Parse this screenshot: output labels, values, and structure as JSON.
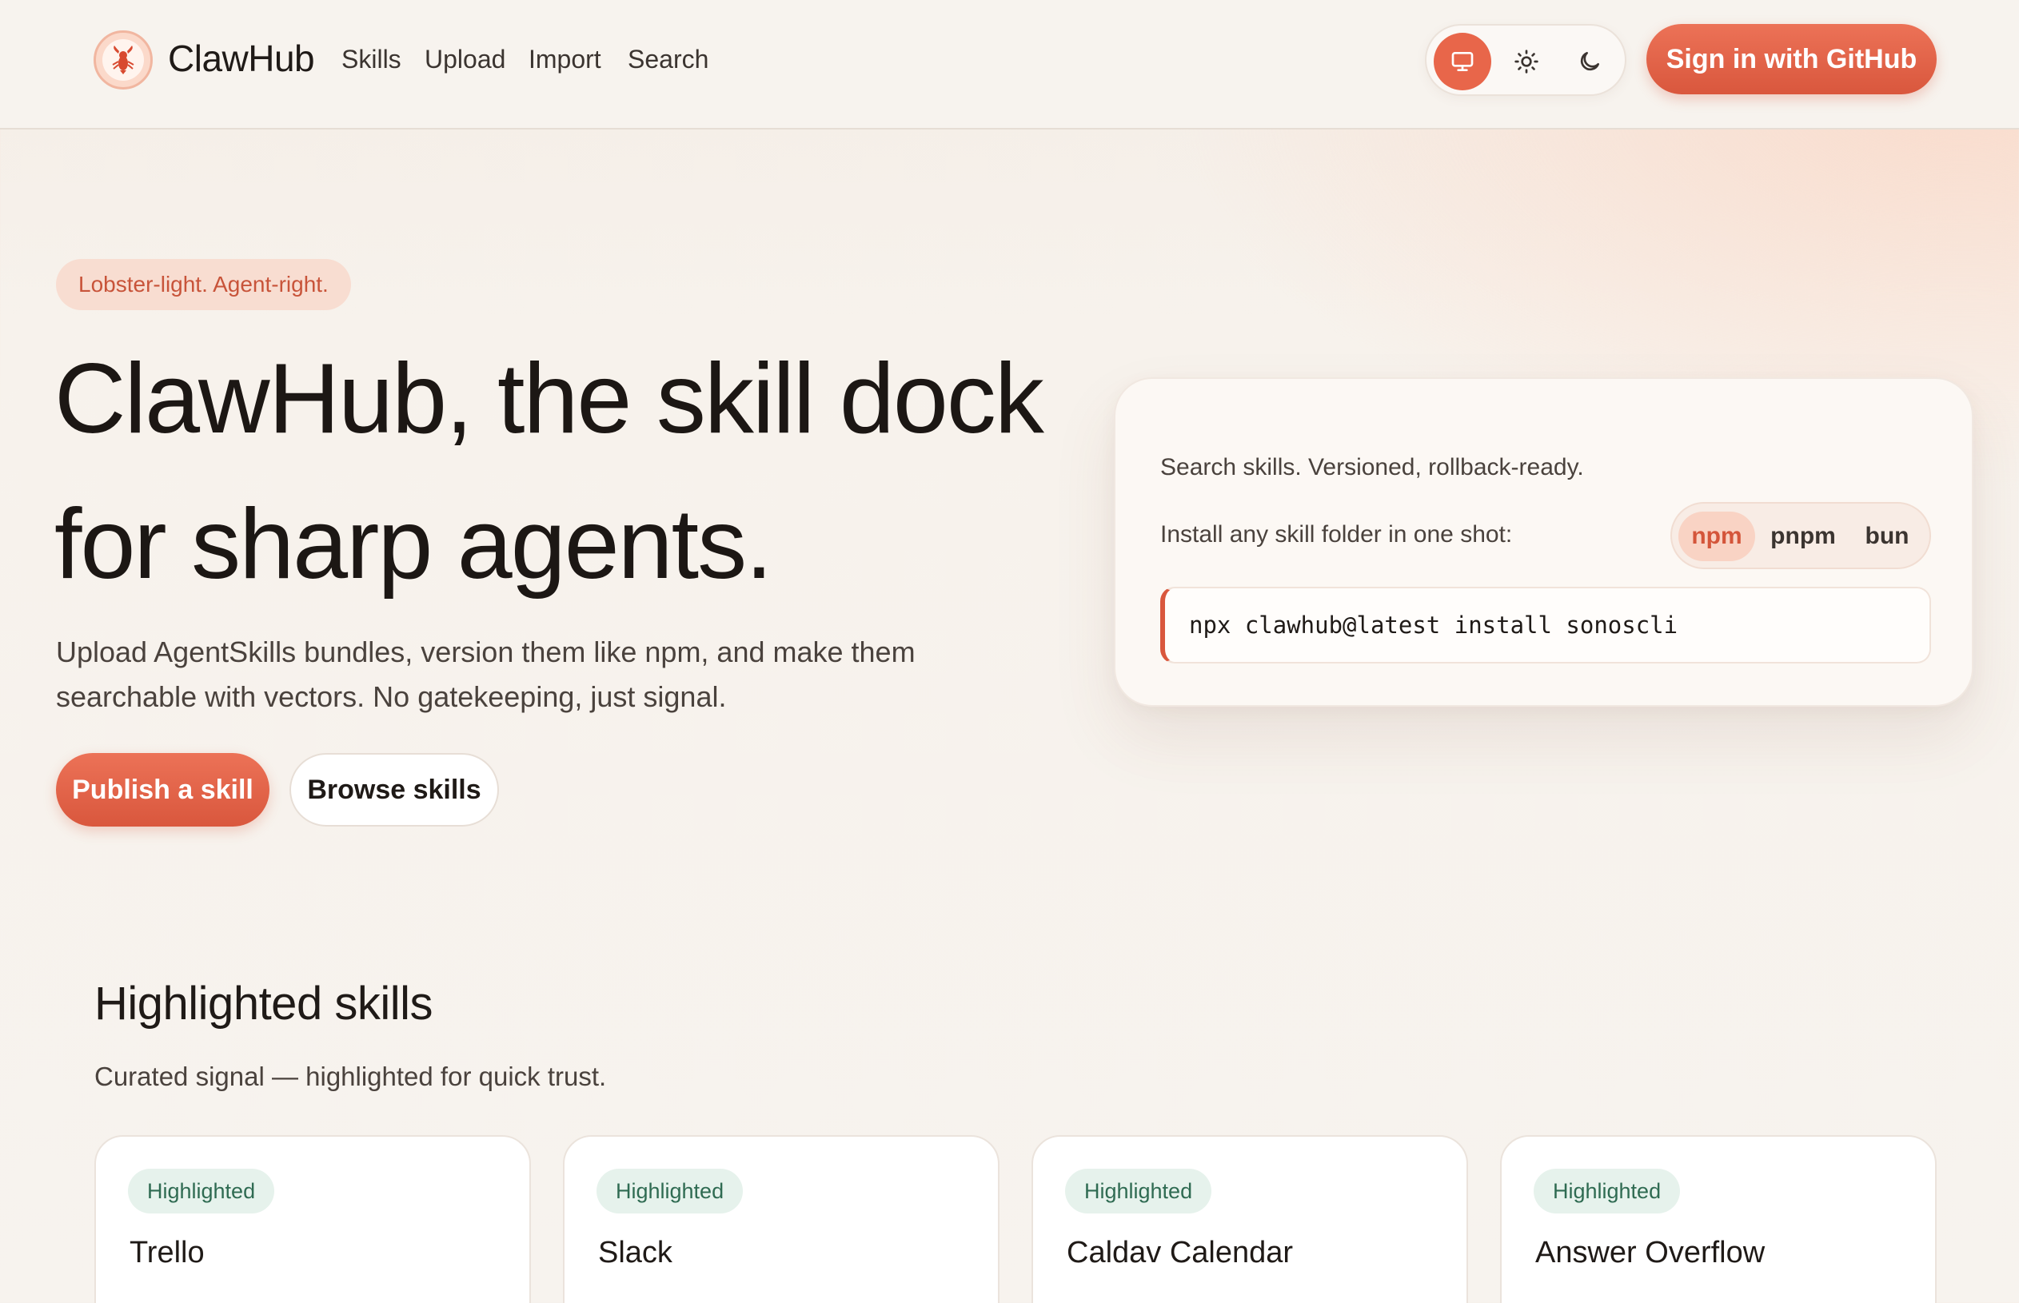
{
  "nav": {
    "brand": "ClawHub",
    "logo_icon": "lobster-icon",
    "links": [
      "Skills",
      "Upload",
      "Import",
      "Search"
    ],
    "theme_options": [
      "system",
      "light",
      "dark"
    ],
    "theme_selected": "system",
    "signin_label": "Sign in  with GitHub"
  },
  "hero": {
    "tagline": "Lobster-light. Agent-right.",
    "title_line1": "ClawHub, the skill dock",
    "title_line2": "for sharp agents.",
    "subtitle_line1": "Upload AgentSkills bundles, version them like npm, and make them",
    "subtitle_line2": "searchable with vectors. No gatekeeping, just signal.",
    "primary_cta": "Publish a skill",
    "secondary_cta": "Browse skills"
  },
  "install_card": {
    "line1": "Search skills. Versioned, rollback-ready.",
    "line2": "Install any skill folder in one shot:",
    "package_managers": [
      "npm",
      "pnpm",
      "bun"
    ],
    "selected_pm": "npm",
    "command": "npx clawhub@latest install sonoscli"
  },
  "highlighted": {
    "title": "Highlighted skills",
    "subtitle": "Curated signal — highlighted for quick trust.",
    "cards": [
      {
        "badge": "Highlighted",
        "name": "Trello"
      },
      {
        "badge": "Highlighted",
        "name": "Slack"
      },
      {
        "badge": "Highlighted",
        "name": "Caldav Calendar"
      },
      {
        "badge": "Highlighted",
        "name": "Answer Overflow"
      }
    ]
  },
  "colors": {
    "accent": "#e8664a",
    "background": "#f7f3ee",
    "badge_bg": "#e6f2ec",
    "badge_text": "#2f6b52"
  }
}
